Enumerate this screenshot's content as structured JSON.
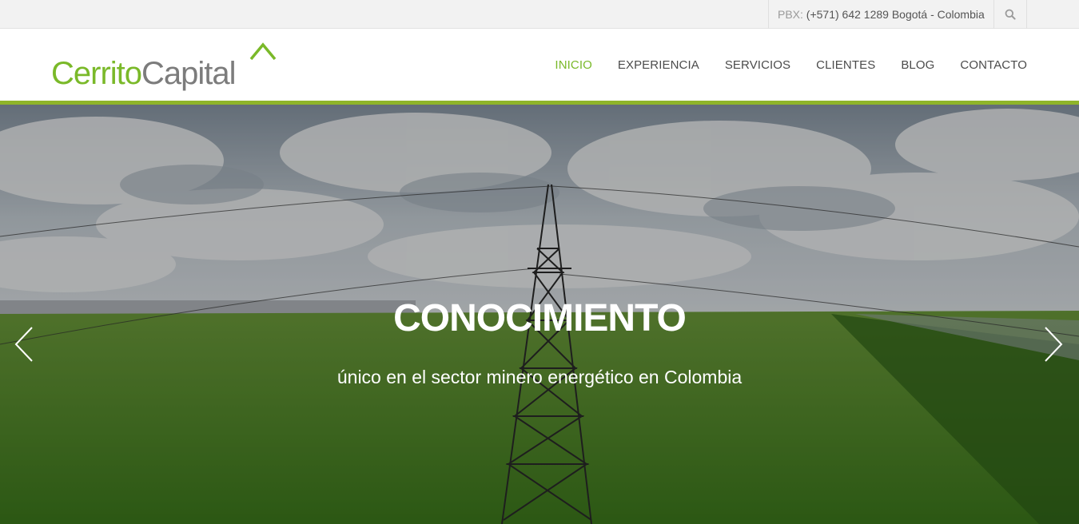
{
  "topbar": {
    "phone_label": "PBX:",
    "phone_value": "(+571) 642 1289 Bogotá - Colombia",
    "search_icon": "search-icon"
  },
  "logo": {
    "part1": "Cerrito",
    "part2": "Capital",
    "mark_icon": "caret-up-icon"
  },
  "nav": {
    "items": [
      {
        "label": "INICIO"
      },
      {
        "label": "EXPERIENCIA"
      },
      {
        "label": "SERVICIOS"
      },
      {
        "label": "CLIENTES"
      },
      {
        "label": "BLOG"
      },
      {
        "label": "CONTACTO"
      }
    ]
  },
  "hero": {
    "title": "CONOCIMIENTO",
    "subtitle": "único en el sector minero energético en Colombia",
    "prev_icon": "chevron-left-icon",
    "next_icon": "chevron-right-icon"
  },
  "colors": {
    "brand_green": "#7ab929",
    "accent_line": "#8fb52a",
    "nav_text": "#4b4b4b"
  }
}
